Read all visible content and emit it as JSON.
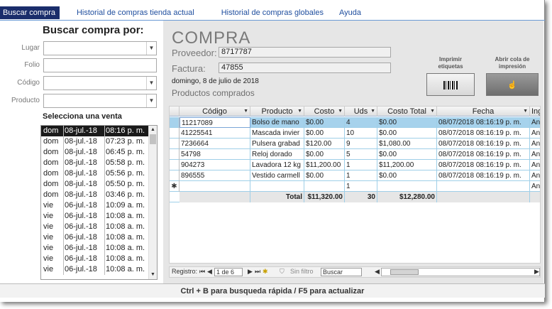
{
  "tabs": [
    {
      "label": "Buscar compra"
    },
    {
      "label": "Historial de compras tienda actual"
    },
    {
      "label": "Historial de compras globales"
    },
    {
      "label": "Ayuda"
    }
  ],
  "search": {
    "title": "Buscar compra por:",
    "fields": [
      {
        "label": "Lugar",
        "value": ""
      },
      {
        "label": "Folio",
        "value": ""
      },
      {
        "label": "Código",
        "value": ""
      },
      {
        "label": "Producto",
        "value": ""
      }
    ],
    "sales_title": "Selecciona una venta",
    "sales": [
      [
        "dom",
        "08-jul.-18",
        "08:16 p. m."
      ],
      [
        "dom",
        "08-jul.-18",
        "07:23 p. m."
      ],
      [
        "dom",
        "08-jul.-18",
        "06:45 p. m."
      ],
      [
        "dom",
        "08-jul.-18",
        "05:58 p. m."
      ],
      [
        "dom",
        "08-jul.-18",
        "05:56 p. m."
      ],
      [
        "dom",
        "08-jul.-18",
        "05:50 p. m."
      ],
      [
        "dom",
        "08-jul.-18",
        "03:46 p. m."
      ],
      [
        "vie",
        "06-jul.-18",
        "10:09 a. m."
      ],
      [
        "vie",
        "06-jul.-18",
        "10:08 a. m."
      ],
      [
        "vie",
        "06-jul.-18",
        "10:08 a. m."
      ],
      [
        "vie",
        "06-jul.-18",
        "10:08 a. m."
      ],
      [
        "vie",
        "06-jul.-18",
        "10:08 a. m."
      ],
      [
        "vie",
        "06-jul.-18",
        "10:08 a. m."
      ],
      [
        "vie",
        "06-jul.-18",
        "10:08 a. m."
      ]
    ]
  },
  "compra": {
    "title": "COMPRA",
    "proveedor_label": "Proveedor:",
    "proveedor_value": "8717787",
    "factura_label": "Factura:",
    "factura_value": "47855",
    "date": "domingo, 8 de julio de 2018",
    "products_title": "Productos comprados",
    "print_button": "Imprimir etiquetas",
    "queue_button": "Abrir cola de impresión"
  },
  "grid": {
    "headers": [
      "Código",
      "Producto",
      "Costo",
      "Uds",
      "Costo Total",
      "Fecha",
      "Ing"
    ],
    "rows": [
      [
        "11217089",
        "Bolso de mano",
        "$0.00",
        "4",
        "$0.00",
        "08/07/2018 08:16:19 p. m.",
        "An"
      ],
      [
        "41225541",
        "Mascada invier",
        "$0.00",
        "10",
        "$0.00",
        "08/07/2018 08:16:19 p. m.",
        "An"
      ],
      [
        "7236664",
        "Pulsera grabad",
        "$120.00",
        "9",
        "$1,080.00",
        "08/07/2018 08:16:19 p. m.",
        "An"
      ],
      [
        "54798",
        "Reloj dorado",
        "$0.00",
        "5",
        "$0.00",
        "08/07/2018 08:16:19 p. m.",
        "An"
      ],
      [
        "904273",
        "Lavadora 12 kg",
        "$11,200.00",
        "1",
        "$11,200.00",
        "08/07/2018 08:16:19 p. m.",
        "An"
      ],
      [
        "896555",
        "Vestido carmell",
        "$0.00",
        "1",
        "$0.00",
        "08/07/2018 08:16:19 p. m.",
        "An"
      ]
    ],
    "new_row_marker": "✱",
    "new_row_uds": "1",
    "new_row_ing": "An",
    "total_label": "Total",
    "total_costo": "$11,320.00",
    "total_uds": "30",
    "total_costo_total": "$12,280.00"
  },
  "navbar": {
    "label": "Registro:",
    "position": "1 de 6",
    "filter": "Sin filtro",
    "search": "Buscar"
  },
  "hint": "Ctrl + B para busqueda rápida / F5 para actualizar"
}
